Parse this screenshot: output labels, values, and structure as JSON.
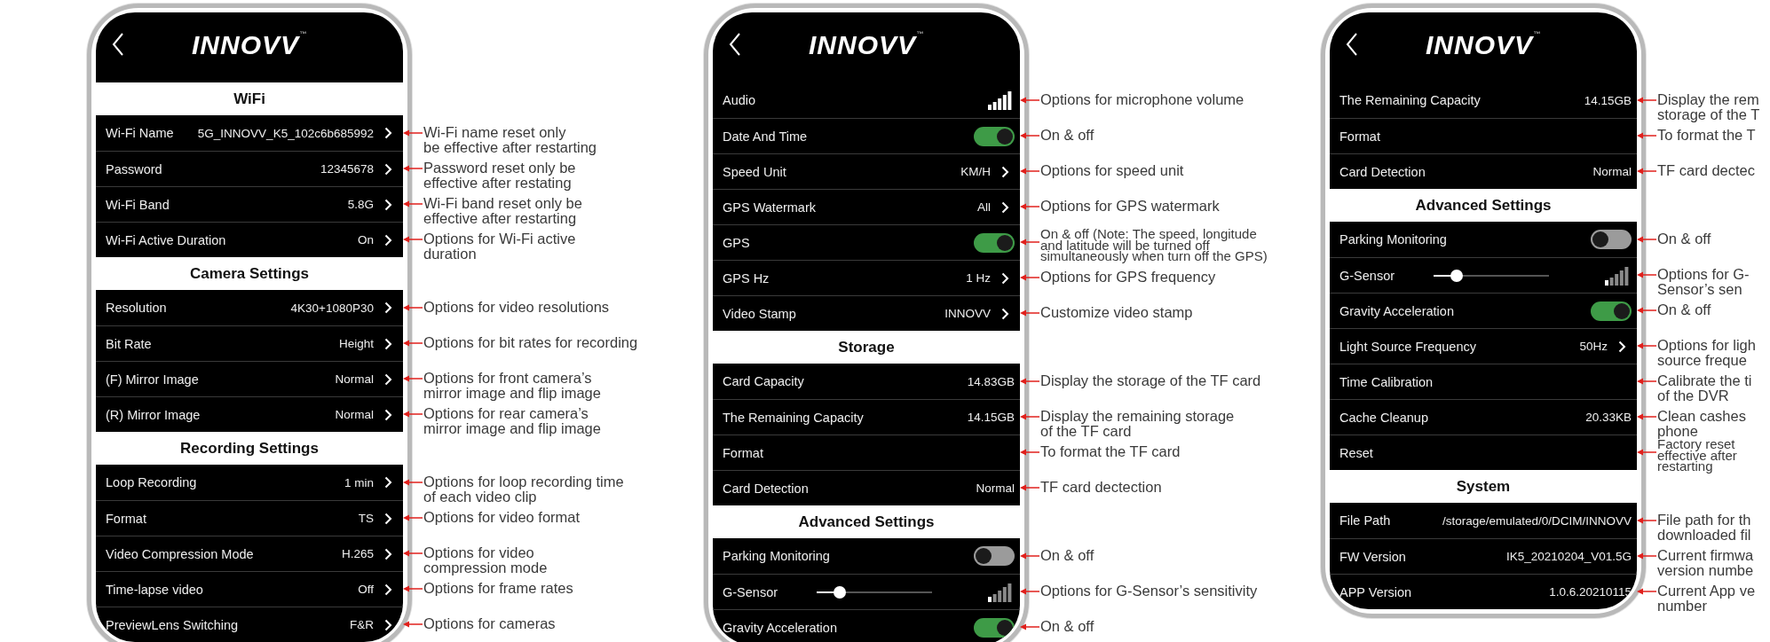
{
  "phones": [
    {
      "logo": "INNOVV",
      "logo_mark": "™",
      "groups": [
        {
          "title": "WiFi",
          "rows": [
            {
              "kind": "nav",
              "label": "Wi-Fi Name",
              "value": "5G_INNOVV_K5_102c6b685992",
              "note": [
                "Wi-Fi name reset only",
                "be effective after restarting"
              ]
            },
            {
              "kind": "nav",
              "label": "Password",
              "value": "12345678",
              "note": [
                "Password reset only be",
                "effective after restating"
              ]
            },
            {
              "kind": "nav",
              "label": "Wi-Fi Band",
              "value": "5.8G",
              "note": [
                "Wi-Fi band reset only be",
                "effective after restarting"
              ]
            },
            {
              "kind": "nav",
              "label": "Wi-Fi Active Duration",
              "value": "On",
              "note": [
                "Options for Wi-Fi active",
                "duration"
              ]
            }
          ]
        },
        {
          "title": "Camera Settings",
          "rows": [
            {
              "kind": "nav",
              "label": "Resolution",
              "value": "4K30+1080P30",
              "note": [
                "Options for video resolutions"
              ]
            },
            {
              "kind": "nav",
              "label": "Bit Rate",
              "value": "Height",
              "note": [
                "Options for bit rates  for recording"
              ]
            },
            {
              "kind": "nav",
              "label": "(F) Mirror Image",
              "value": "Normal",
              "note": [
                "Options for front camera’s",
                "mirror image and flip image"
              ]
            },
            {
              "kind": "nav",
              "label": "(R) Mirror Image",
              "value": "Normal",
              "note": [
                "Options for rear camera’s",
                "mirror image and flip image"
              ]
            }
          ]
        },
        {
          "title": "Recording Settings",
          "rows": [
            {
              "kind": "nav",
              "label": "Loop Recording",
              "value": "1 min",
              "note": [
                "Options for loop recording time",
                "of each video clip"
              ]
            },
            {
              "kind": "nav",
              "label": "Format",
              "value": "TS",
              "note": [
                "Options for video format"
              ]
            },
            {
              "kind": "nav",
              "label": "Video Compression Mode",
              "value": "H.265",
              "note": [
                "Options for video",
                "compression mode"
              ]
            },
            {
              "kind": "nav",
              "label": "Time-lapse video",
              "value": "Off",
              "note": [
                "Options for frame rates"
              ]
            },
            {
              "kind": "nav",
              "label": "PreviewLens Switching",
              "value": "F&R",
              "note": [
                "Options for cameras"
              ]
            }
          ]
        }
      ]
    },
    {
      "logo": "INNOVV",
      "logo_mark": "™",
      "groups": [
        {
          "rows": [
            {
              "kind": "volume",
              "label": "Audio",
              "note": [
                "Options for microphone volume"
              ]
            },
            {
              "kind": "toggle",
              "label": "Date And Time",
              "on": true,
              "note": [
                "On & off"
              ]
            },
            {
              "kind": "nav",
              "label": "Speed Unit",
              "value": "KM/H",
              "note": [
                "Options for speed unit"
              ]
            },
            {
              "kind": "nav",
              "label": "GPS Watermark",
              "value": "All",
              "note": [
                "Options for GPS watermark"
              ]
            },
            {
              "kind": "toggle",
              "label": "GPS",
              "on": true,
              "note": [
                "On & off (Note: The speed, longitude",
                "and latitude will be turned off",
                "simultaneously when turn off the GPS)"
              ]
            },
            {
              "kind": "nav",
              "label": "GPS Hz",
              "value": "1 Hz",
              "note": [
                "Options for GPS  frequency"
              ]
            },
            {
              "kind": "nav",
              "label": "Video Stamp",
              "value": "INNOVV",
              "note": [
                "Customize video stamp"
              ]
            }
          ]
        },
        {
          "title": "Storage",
          "rows": [
            {
              "kind": "info",
              "label": "Card Capacity",
              "value": "14.83GB",
              "note": [
                "Display the storage of the TF card"
              ]
            },
            {
              "kind": "info",
              "label": "The Remaining Capacity",
              "value": "14.15GB",
              "note": [
                "Display the remaining storage",
                "of the TF card"
              ]
            },
            {
              "kind": "action",
              "label": "Format",
              "note": [
                "To format the TF card"
              ]
            },
            {
              "kind": "info",
              "label": "Card Detection",
              "value": "Normal",
              "note": [
                "TF card dectection"
              ]
            }
          ]
        },
        {
          "title": "Advanced Settings",
          "rows": [
            {
              "kind": "toggle",
              "label": "Parking Monitoring",
              "on": false,
              "note": [
                "On & off"
              ]
            },
            {
              "kind": "slider",
              "label": "G-Sensor",
              "level": 0.2,
              "note": [
                "Options for G-Sensor’s  sensitivity"
              ]
            },
            {
              "kind": "toggle",
              "label": "Gravity Acceleration",
              "on": true,
              "note": [
                "On & off"
              ]
            }
          ]
        }
      ]
    },
    {
      "logo": "INNOVV",
      "logo_mark": "™",
      "groups": [
        {
          "rows": [
            {
              "kind": "info",
              "label": "The Remaining Capacity",
              "value": "14.15GB",
              "note": [
                "Display the rem",
                "storage of the T"
              ]
            },
            {
              "kind": "action",
              "label": "Format",
              "note": [
                "To format the T"
              ]
            },
            {
              "kind": "info",
              "label": "Card Detection",
              "value": "Normal",
              "note": [
                "TF card dectec"
              ]
            }
          ]
        },
        {
          "title": "Advanced Settings",
          "rows": [
            {
              "kind": "toggle",
              "label": "Parking Monitoring",
              "on": false,
              "note": [
                "On & off"
              ]
            },
            {
              "kind": "slider",
              "label": "G-Sensor",
              "level": 0.2,
              "note": [
                "Options for G-",
                "Sensor’s sen"
              ]
            },
            {
              "kind": "toggle",
              "label": "Gravity Acceleration",
              "on": true,
              "note": [
                "On & off"
              ]
            },
            {
              "kind": "nav",
              "label": "Light Source Frequency",
              "value": "50Hz",
              "note": [
                "Options for ligh",
                "source freque"
              ]
            },
            {
              "kind": "action",
              "label": "Time Calibration",
              "note": [
                "Calibrate the ti",
                "of the DVR"
              ]
            },
            {
              "kind": "info",
              "label": "Cache Cleanup",
              "value": "20.33KB",
              "note": [
                "Clean cashes",
                "phone"
              ]
            },
            {
              "kind": "action",
              "label": "Reset",
              "note": [
                "Factory reset",
                "effective after",
                "restarting"
              ]
            }
          ]
        },
        {
          "title": "System",
          "rows": [
            {
              "kind": "info",
              "label": "File Path",
              "value": "/storage/emulated/0/DCIM/INNOVV",
              "note": [
                "File path for th",
                "downloaded fil"
              ]
            },
            {
              "kind": "info",
              "label": "FW Version",
              "value": "IK5_20210204_V01.5G",
              "note": [
                "Current firmwa",
                "version numbe"
              ]
            },
            {
              "kind": "info",
              "label": "APP Version",
              "value": "1.0.6.20210115",
              "note": [
                "Current App ve",
                "number"
              ]
            }
          ]
        }
      ]
    }
  ]
}
